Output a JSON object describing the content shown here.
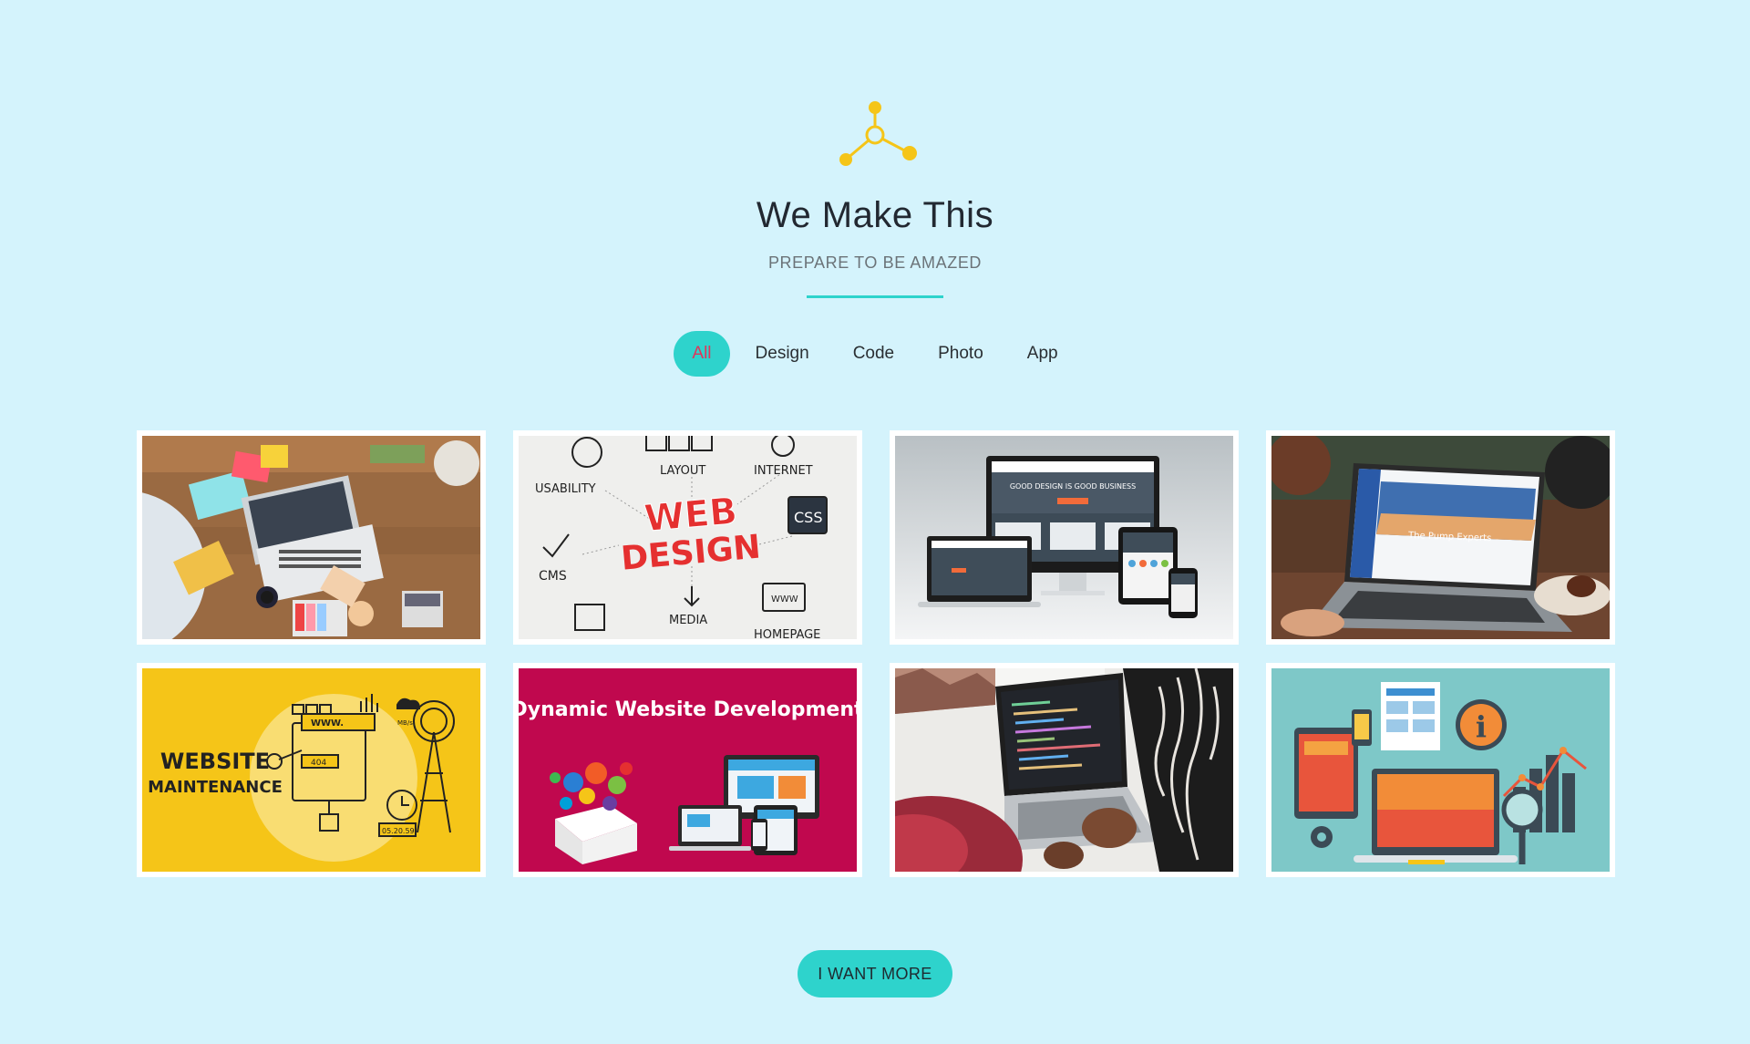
{
  "header": {
    "icon": "molecule-share-icon",
    "title": "We Make This",
    "subtitle": "PREPARE TO BE AMAZED"
  },
  "filters": {
    "active_index": 0,
    "items": [
      {
        "label": "All"
      },
      {
        "label": "Design"
      },
      {
        "label": "Code"
      },
      {
        "label": "Photo"
      },
      {
        "label": "App"
      }
    ]
  },
  "portfolio": {
    "items": [
      {
        "kind": "photo-laptop-desk"
      },
      {
        "kind": "web-design-sketch",
        "texts": {
          "t1": "WEB",
          "t2": "DESIGN",
          "t3": "USABILITY",
          "t4": "LAYOUT",
          "t5": "INTERNET",
          "t6": "CSS",
          "t7": "CMS",
          "t8": "MEDIA",
          "t9": "HOMEPAGE",
          "t10": "WWW"
        }
      },
      {
        "kind": "responsive-devices",
        "texts": {
          "t1": "GOOD DESIGN IS GOOD BUSINESS"
        }
      },
      {
        "kind": "photo-laptop-cafe",
        "texts": {
          "t1": "The Pump Experts"
        }
      },
      {
        "kind": "website-maintenance",
        "texts": {
          "t1": "WEBSITE",
          "t2": "MAINTENANCE",
          "t3": "WWW.",
          "t4": "404",
          "t5": "05.20.59",
          "t6": "MB/s"
        }
      },
      {
        "kind": "dynamic-dev",
        "texts": {
          "t1": "Dynamic Website Development"
        }
      },
      {
        "kind": "photo-coding"
      },
      {
        "kind": "flat-illustration"
      }
    ]
  },
  "cta": {
    "label": "I WANT MORE"
  },
  "colors": {
    "background": "#d4f3fc",
    "accent": "#2ed3cc",
    "active_tab_text": "#e0355b",
    "icon": "#f5c518"
  }
}
